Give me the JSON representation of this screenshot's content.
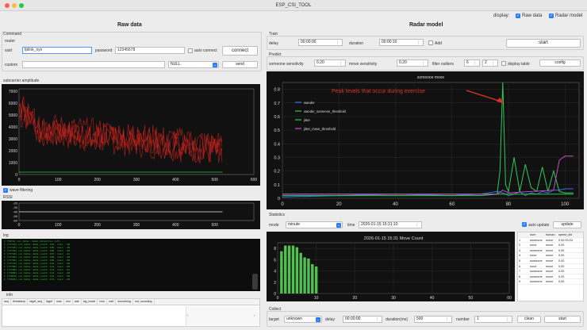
{
  "window": {
    "title": "ESP_CSI_TOOL"
  },
  "display": {
    "label": "display:",
    "raw_data": "Raw data",
    "radar_model": "Radar model"
  },
  "left": {
    "title": "Raw data",
    "command": "Command",
    "router": "router",
    "ssid_label": "ssid",
    "ssid_value": "fplink_nyx",
    "password_label": "password",
    "password_value": "12345678",
    "auto_connect": "auto connect",
    "connect_btn": "connect",
    "custom_label": "custom",
    "custom_select": "NULL",
    "send_btn": "send",
    "amp_label": "subcarrier amplitude",
    "wave_filtering": "wave filtering",
    "rssi_label": "RSSI",
    "log_label": "log",
    "log_lines": [
      "[ 77674] csi_data: radar_detection info ...",
      "I (77710) csi_data: data_count: 104, rssi: -40",
      "I (77720) csi_data: data_count: 105, rssi: -39",
      "I (77730) csi_data: data_count: 106, rssi: -40",
      "I (77740) csi_data: data_count: 107, rssi: -41",
      "I (77750) csi_data: data_count: 108, rssi: -40",
      "I (77760) csi_data: data_count: 109, rssi: -39",
      "I (77770) csi_data: data_count: 110, rssi: -40",
      "I (77780) csi_data: data_count: 111, rssi: -40",
      "I (77790) csi_data: data_count: 112, rssi: -41",
      "I (77800) csi_data: data_count: 113, rssi: -40",
      "I (77810) csi_data: data_count: 114, rssi: -39",
      "I (77820) csi_data: data_count: 115, rssi: -40"
    ],
    "info_label": "info",
    "info_columns": [
      "seq",
      "timestamp",
      "taget_seq",
      "taget",
      "mac",
      "rssi",
      "rate",
      "sig_mode",
      "mcs",
      "cwb",
      "smoothing",
      "not_sounding"
    ]
  },
  "right": {
    "title": "Radar model",
    "train": "Train",
    "delay_label": "delay",
    "delay_value": "00:00:00",
    "duration_label": "duration",
    "duration_value": "00:00:10",
    "add_label": "Add",
    "start_btn": "start",
    "predict": "Predict",
    "someone_sens_label": "someone sensitivity",
    "someone_sens_value": "0.20",
    "move_sens_label": "move sensitivity",
    "move_sens_value": "0.20",
    "filter_outliers_label": "filter outliers",
    "filter_a": "6",
    "filter_b": "2",
    "display_table": "display table",
    "config_btn": "config",
    "statistics": "Statistics",
    "mode_label": "mode",
    "mode_value": "minute",
    "time_label": "time",
    "time_value": "2026-01-15 15:31:10",
    "auto_update": "auto update",
    "update_btn": "update",
    "collect": "Collect",
    "target_label": "target",
    "target_value": "unknown",
    "cdelay_label": "delay",
    "cdelay_value": "00:00:00",
    "cduration_label": "duration(ms)",
    "cduration_value": "500",
    "number_label": "number",
    "number_value": "1",
    "clean_btn": "clean",
    "cstart_btn": "start",
    "stat_table": {
      "columns": [
        "num",
        "human",
        "speed_idx"
      ],
      "rows": [
        [
          "1",
          "someone",
          "move",
          "0.00:03:24"
        ],
        [
          "2",
          "none",
          "move",
          "0.00"
        ],
        [
          "3",
          "someone",
          "move",
          "0.00"
        ],
        [
          "4",
          "none",
          "move",
          "0.00"
        ],
        [
          "5",
          "someone",
          "move",
          "0.00"
        ],
        [
          "6",
          "none",
          "move",
          "0.00"
        ],
        [
          "7",
          "someone",
          "move",
          "0.00"
        ],
        [
          "8",
          "someone",
          "move",
          "0.00"
        ],
        [
          "9",
          "someone",
          "move",
          "0.00"
        ]
      ]
    }
  },
  "chart_data": [
    {
      "type": "line",
      "title": "",
      "x_ticks": [
        "0",
        "100",
        "200",
        "300",
        "400",
        "500",
        "600"
      ],
      "y_ticks": [
        "0",
        "1000",
        "2000",
        "3000",
        "4000",
        "5000",
        "6000",
        "7000"
      ],
      "xlim": [
        0,
        600
      ],
      "ylim": [
        0,
        7200
      ],
      "series_color": "#d0231c",
      "baseline_color": "#2ecc40"
    },
    {
      "type": "line",
      "title": "",
      "x_ticks": [
        "0",
        "100",
        "200",
        "300",
        "400",
        "500"
      ],
      "y_ticks": [
        "-20",
        "-30",
        "-40",
        "-50",
        "-60"
      ],
      "xlim": [
        0,
        600
      ],
      "ylim": [
        -60,
        -20
      ]
    },
    {
      "type": "line",
      "title": "someone move",
      "annotation": "Peak levels that occur during exercise",
      "x_ticks": [
        "0",
        "20",
        "40",
        "60",
        "80",
        "100"
      ],
      "y_ticks": [
        "0",
        "0.1",
        "0.2",
        "0.3",
        "0.4",
        "0.5",
        "0.6",
        "0.7",
        "0.8"
      ],
      "xlim": [
        0,
        105
      ],
      "ylim": [
        0,
        0.85
      ],
      "legend_position": "top-left",
      "series": [
        {
          "name": "wander",
          "color": "#3a6ff2",
          "x": [
            0,
            20,
            40,
            60,
            70,
            76,
            78,
            80,
            82,
            84,
            86,
            88,
            90,
            92,
            94,
            96,
            98,
            100,
            102,
            103
          ],
          "y": [
            0.01,
            0.02,
            0.03,
            0.02,
            0.03,
            0.05,
            0.04,
            0.02,
            0.03,
            0.05,
            0.02,
            0.04,
            0.03,
            0.05,
            0.04,
            0.06,
            0.06,
            0.07,
            0.07,
            0.07
          ]
        },
        {
          "name": "wander_someone_threshold",
          "color": "#2ecc40",
          "x": [
            0,
            103
          ],
          "y": [
            0.03,
            0.03
          ]
        },
        {
          "name": "jitter",
          "color": "#31c85a",
          "x": [
            0,
            20,
            40,
            60,
            70,
            76,
            77,
            78,
            79,
            80,
            82,
            84,
            86,
            88,
            90,
            92,
            94,
            96,
            98,
            100,
            103
          ],
          "y": [
            0.02,
            0.02,
            0.02,
            0.02,
            0.02,
            0.03,
            0.2,
            0.85,
            0.1,
            0.05,
            0.3,
            0.05,
            0.25,
            0.08,
            0.05,
            0.23,
            0.05,
            0.2,
            0.05,
            0.04,
            0.04
          ]
        },
        {
          "name": "jitter_move_threshold",
          "color": "#c44fc4",
          "x": [
            0,
            76,
            78,
            80,
            96,
            98,
            100,
            103
          ],
          "y": [
            0.03,
            0.03,
            0.06,
            0.04,
            0.06,
            0.28,
            0.31,
            0.31
          ]
        }
      ]
    },
    {
      "type": "bar",
      "title": "2026-01-15 15:31 Move Count",
      "x_ticks": [
        "0",
        "10",
        "20",
        "30",
        "40",
        "50",
        "60"
      ],
      "y_ticks": [
        "0",
        "2",
        "4",
        "6",
        "8"
      ],
      "xlim": [
        0,
        60
      ],
      "ylim": [
        0,
        9
      ],
      "bar_color": "#52c24f",
      "x": [
        1,
        2,
        3,
        4,
        5,
        6,
        7,
        8,
        9,
        10
      ],
      "values": [
        7.5,
        8.5,
        8.5,
        8.5,
        8.2,
        7.2,
        6.4,
        6.2,
        5.2,
        4.8
      ]
    }
  ]
}
